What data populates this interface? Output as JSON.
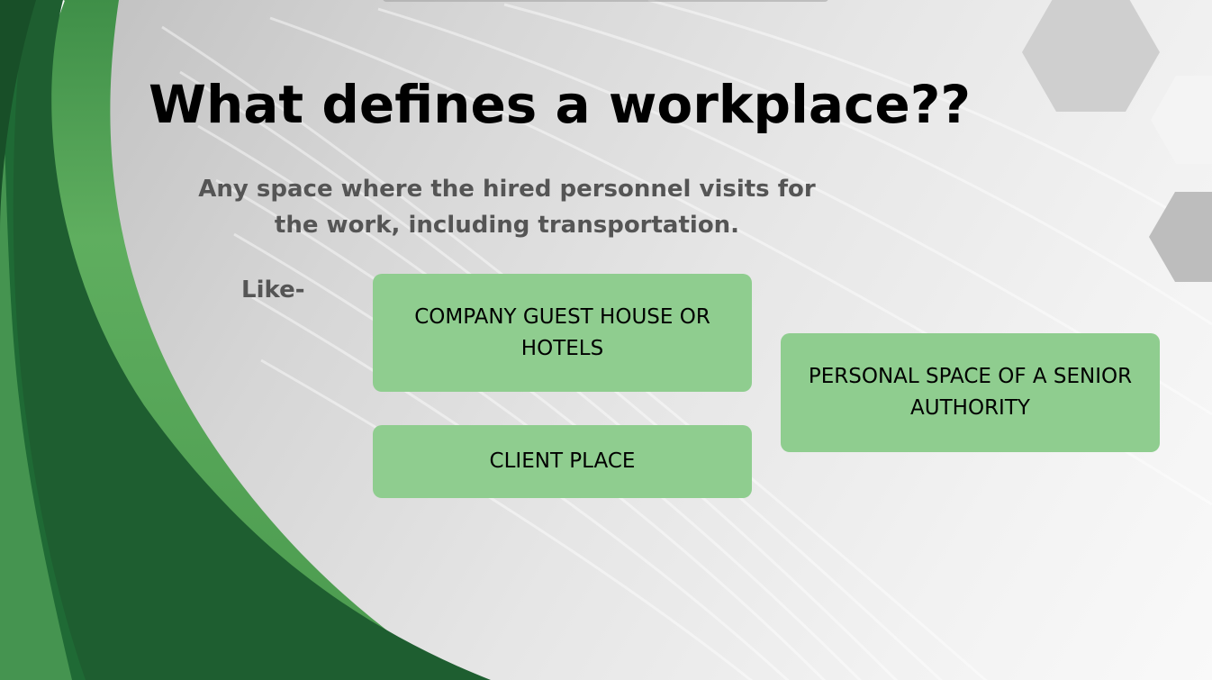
{
  "slide": {
    "title": "What defines a workplace??",
    "subtitle": "Any space where the hired personnel visits for the work, including transportation.",
    "like_label": "Like-",
    "cards": [
      {
        "label": "COMPANY GUEST HOUSE OR HOTELS"
      },
      {
        "label": "CLIENT PLACE"
      },
      {
        "label": "PERSONAL SPACE OF A SENIOR AUTHORITY"
      }
    ]
  },
  "colors": {
    "dark_green": "#1e5e30",
    "light_green": "#5aa85a",
    "card_green": "#8fcd8f",
    "title": "#000000",
    "body_text": "#555555"
  },
  "icons": [
    "hexagon-decoration"
  ]
}
